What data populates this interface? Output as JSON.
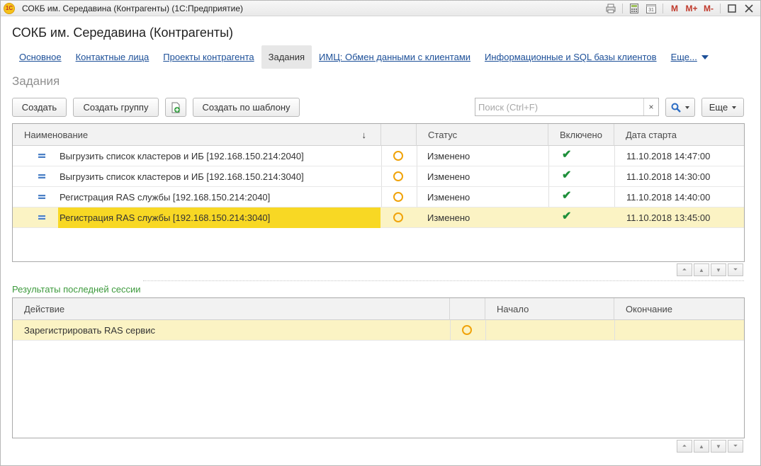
{
  "window": {
    "app_logo_text": "1С",
    "title": "СОКБ им. Середавина (Контрагенты)  (1С:Предприятие)",
    "toolbar": {
      "m_label": "M",
      "m_plus_label": "M+",
      "m_minus_label": "M-",
      "calendar_day": "31"
    }
  },
  "form": {
    "title": "СОКБ им. Середавина (Контрагенты)",
    "section_title": "Задания",
    "tabs": [
      {
        "label": "Основное"
      },
      {
        "label": "Контактные лица"
      },
      {
        "label": "Проекты контрагента"
      },
      {
        "label": "Задания"
      },
      {
        "label": "ИМЦ: Обмен данными с клиентами"
      },
      {
        "label": "Информационные и SQL базы клиентов"
      },
      {
        "label": "Еще..."
      }
    ]
  },
  "toolbar": {
    "create_label": "Создать",
    "create_group_label": "Создать группу",
    "create_by_template_label": "Создать по шаблону",
    "search_placeholder": "Поиск (Ctrl+F)",
    "clear_symbol": "×",
    "more_label": "Еще"
  },
  "tasks_table": {
    "columns": {
      "name": "Наименование",
      "status": "Статус",
      "enabled": "Включено",
      "start_date": "Дата старта"
    },
    "sort_symbol": "↓",
    "rows": [
      {
        "name": "Выгрузить список кластеров и ИБ [192.168.150.214:2040]",
        "status": "Изменено",
        "enabled": "✔",
        "start_date": "11.10.2018 14:47:00"
      },
      {
        "name": "Выгрузить список кластеров и ИБ [192.168.150.214:3040]",
        "status": "Изменено",
        "enabled": "✔",
        "start_date": "11.10.2018 14:30:00"
      },
      {
        "name": "Регистрация RAS службы [192.168.150.214:2040]",
        "status": "Изменено",
        "enabled": "✔",
        "start_date": "11.10.2018 14:40:00"
      },
      {
        "name": "Регистрация RAS службы [192.168.150.214:3040]",
        "status": "Изменено",
        "enabled": "✔",
        "start_date": "11.10.2018 13:45:00"
      }
    ],
    "selected_row": 3
  },
  "results": {
    "title": "Результаты последней сессии",
    "columns": {
      "action": "Действие",
      "start": "Начало",
      "end": "Окончание"
    },
    "rows": [
      {
        "action": "Зарегистрировать RAS сервис",
        "start": "",
        "end": ""
      }
    ]
  },
  "colors": {
    "link": "#1c4f98",
    "selection": "#f8d824",
    "selected_row": "#fbf3c4",
    "status_circle": "#f0a30a",
    "check": "#1e8f3a",
    "subsection": "#3d9a3d"
  }
}
